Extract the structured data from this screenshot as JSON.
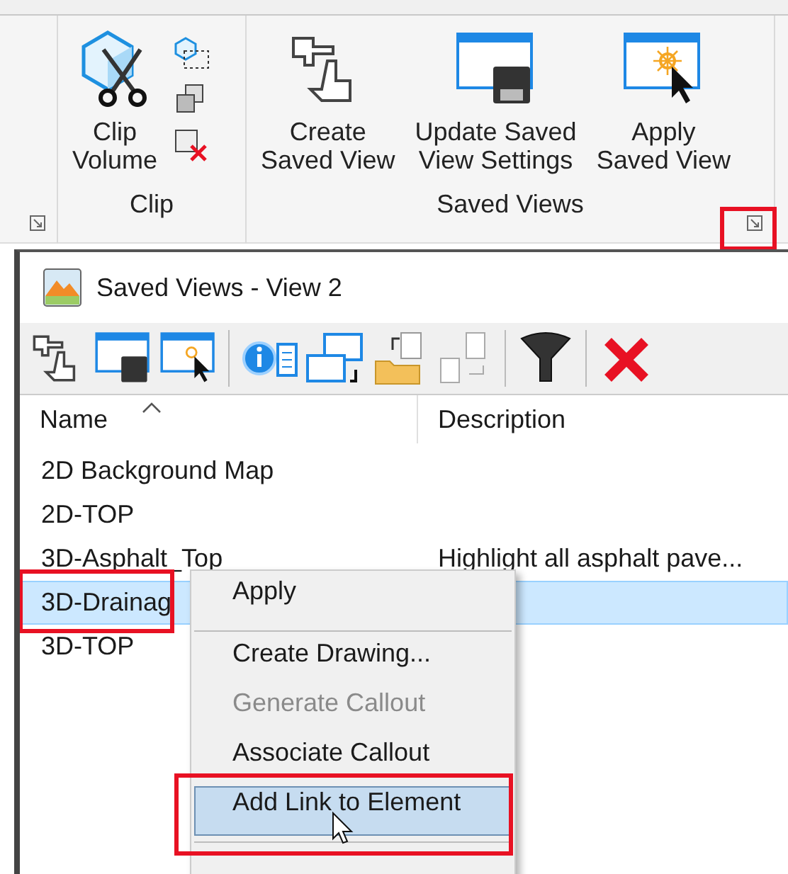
{
  "ribbon": {
    "groups": [
      {
        "launcher": true,
        "annotated": false
      },
      {
        "label": "Clip",
        "launcher": false,
        "annotated": false,
        "buttons": [
          {
            "kind": "clip-volume",
            "label": "Clip\nVolume"
          }
        ]
      },
      {
        "label": "Saved Views",
        "launcher": true,
        "annotated": true,
        "buttons": [
          {
            "kind": "create",
            "label": "Create\nSaved View"
          },
          {
            "kind": "update",
            "label": "Update Saved\nView Settings"
          },
          {
            "kind": "apply",
            "label": "Apply\nSaved View"
          }
        ]
      }
    ]
  },
  "panel": {
    "title": "Saved Views - View 2",
    "columns": [
      {
        "label": "Name",
        "sorted": true
      },
      {
        "label": "Description",
        "sorted": false
      }
    ],
    "rows": [
      {
        "name": "2D Background Map",
        "description": "",
        "selected": false,
        "annotated": false
      },
      {
        "name": "2D-TOP",
        "description": "",
        "selected": false,
        "annotated": false
      },
      {
        "name": "3D-Asphalt_Top",
        "description": "Highlight all asphalt pave...",
        "selected": false,
        "annotated": false
      },
      {
        "name": "3D-Drainag",
        "description": "",
        "selected": true,
        "annotated": true
      },
      {
        "name": "3D-TOP",
        "description": "",
        "selected": false,
        "annotated": false
      }
    ]
  },
  "context_menu": {
    "items": [
      {
        "kind": "item",
        "label": "Apply",
        "disabled": false,
        "selected": false,
        "annotated": false
      },
      {
        "kind": "separator"
      },
      {
        "kind": "item",
        "label": "Create Drawing...",
        "disabled": false,
        "selected": false,
        "annotated": false
      },
      {
        "kind": "item",
        "label": "Generate Callout",
        "disabled": true,
        "selected": false,
        "annotated": false
      },
      {
        "kind": "item",
        "label": "Associate Callout",
        "disabled": false,
        "selected": false,
        "annotated": false
      },
      {
        "kind": "item",
        "label": "Add Link to Element",
        "disabled": false,
        "selected": true,
        "annotated": true
      },
      {
        "kind": "separator"
      }
    ]
  }
}
